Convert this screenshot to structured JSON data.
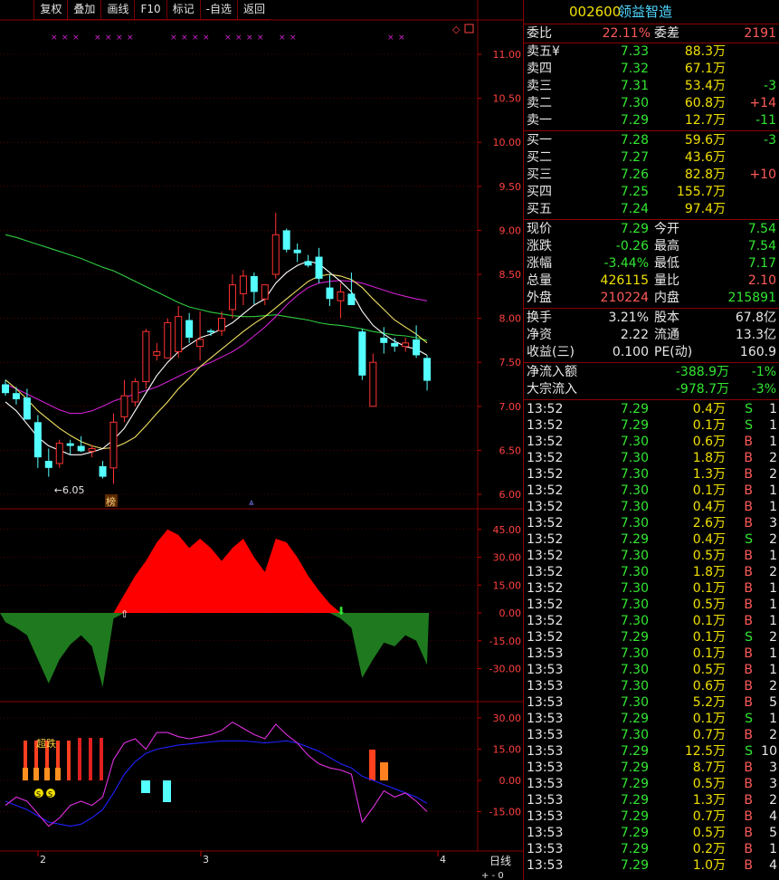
{
  "toolbar": {
    "buttons": [
      "复权",
      "叠加",
      "画线",
      "F10",
      "标记",
      "-自选",
      "返回"
    ]
  },
  "stock": {
    "code": "002600",
    "name": "领益智造"
  },
  "chart": {
    "price_ticks": [
      "11.00",
      "10.50",
      "10.00",
      "9.50",
      "9.00",
      "8.50",
      "8.00",
      "7.50",
      "7.00",
      "6.50",
      "6.00"
    ],
    "low_label": "6.05",
    "rank_label": "榜",
    "macd_ticks": [
      "45.00",
      "30.00",
      "15.00",
      "0.00",
      "-15.00",
      "-30.00"
    ],
    "ind_ticks": [
      "30.00",
      "15.00",
      "0.00",
      "-15.00"
    ],
    "ind_label": "超跌",
    "ind_small": [
      "S",
      "S"
    ],
    "date_labels": [
      "2",
      "3",
      "4"
    ],
    "period_label": "日线",
    "period_controls": "+ - 0",
    "colors": {
      "up": "#ff3232",
      "down": "#54ffff",
      "ma5": "#ffffff",
      "ma10": "#f0e060",
      "ma20": "#2ecc40",
      "ma60": "#d020d0",
      "macd_pos": "#ff0000",
      "macd_neg": "#1f7a1f"
    },
    "candles": [
      {
        "o": 7.25,
        "h": 7.3,
        "l": 7.12,
        "c": 7.15
      },
      {
        "o": 7.15,
        "h": 7.22,
        "l": 7.02,
        "c": 7.08
      },
      {
        "o": 7.1,
        "h": 7.2,
        "l": 6.85,
        "c": 6.85
      },
      {
        "o": 6.82,
        "h": 6.9,
        "l": 6.3,
        "c": 6.42
      },
      {
        "o": 6.38,
        "h": 6.52,
        "l": 6.2,
        "c": 6.3
      },
      {
        "o": 6.35,
        "h": 6.62,
        "l": 6.3,
        "c": 6.58
      },
      {
        "o": 6.58,
        "h": 6.62,
        "l": 6.45,
        "c": 6.55
      },
      {
        "o": 6.55,
        "h": 6.66,
        "l": 6.48,
        "c": 6.49
      },
      {
        "o": 6.49,
        "h": 6.56,
        "l": 6.42,
        "c": 6.52
      },
      {
        "o": 6.32,
        "h": 6.38,
        "l": 6.18,
        "c": 6.2
      },
      {
        "o": 6.3,
        "h": 6.92,
        "l": 6.12,
        "c": 6.82
      },
      {
        "o": 6.88,
        "h": 7.3,
        "l": 6.82,
        "c": 7.12
      },
      {
        "o": 7.05,
        "h": 7.32,
        "l": 7.0,
        "c": 7.28
      },
      {
        "o": 7.28,
        "h": 7.88,
        "l": 7.2,
        "c": 7.85
      },
      {
        "o": 7.58,
        "h": 7.72,
        "l": 7.52,
        "c": 7.62
      },
      {
        "o": 7.55,
        "h": 8.0,
        "l": 7.55,
        "c": 7.95
      },
      {
        "o": 7.62,
        "h": 8.14,
        "l": 7.55,
        "c": 8.02
      },
      {
        "o": 7.98,
        "h": 8.06,
        "l": 7.72,
        "c": 7.78
      },
      {
        "o": 7.68,
        "h": 8.08,
        "l": 7.52,
        "c": 7.76
      },
      {
        "o": 7.86,
        "h": 7.88,
        "l": 7.8,
        "c": 7.84
      },
      {
        "o": 7.86,
        "h": 8.08,
        "l": 7.8,
        "c": 8.0
      },
      {
        "o": 8.1,
        "h": 8.5,
        "l": 8.0,
        "c": 8.38
      },
      {
        "o": 8.28,
        "h": 8.55,
        "l": 8.15,
        "c": 8.48
      },
      {
        "o": 8.48,
        "h": 8.52,
        "l": 8.16,
        "c": 8.3
      },
      {
        "o": 8.22,
        "h": 8.38,
        "l": 8.15,
        "c": 8.38
      },
      {
        "o": 8.5,
        "h": 9.2,
        "l": 8.45,
        "c": 8.95
      },
      {
        "o": 9.0,
        "h": 9.02,
        "l": 8.75,
        "c": 8.78
      },
      {
        "o": 8.78,
        "h": 8.85,
        "l": 8.64,
        "c": 8.74
      },
      {
        "o": 8.65,
        "h": 8.72,
        "l": 8.58,
        "c": 8.6
      },
      {
        "o": 8.7,
        "h": 8.8,
        "l": 8.4,
        "c": 8.45
      },
      {
        "o": 8.35,
        "h": 8.5,
        "l": 8.14,
        "c": 8.22
      },
      {
        "o": 8.2,
        "h": 8.4,
        "l": 8.0,
        "c": 8.3
      },
      {
        "o": 8.28,
        "h": 8.52,
        "l": 8.15,
        "c": 8.15
      },
      {
        "o": 7.85,
        "h": 7.88,
        "l": 7.3,
        "c": 7.35
      },
      {
        "o": 7.0,
        "h": 7.6,
        "l": 7.0,
        "c": 7.5
      },
      {
        "o": 7.78,
        "h": 7.9,
        "l": 7.6,
        "c": 7.72
      },
      {
        "o": 7.72,
        "h": 7.78,
        "l": 7.62,
        "c": 7.68
      },
      {
        "o": 7.68,
        "h": 7.78,
        "l": 7.62,
        "c": 7.72
      },
      {
        "o": 7.76,
        "h": 7.92,
        "l": 7.55,
        "c": 7.58
      },
      {
        "o": 7.55,
        "h": 7.58,
        "l": 7.18,
        "c": 7.29
      }
    ],
    "ma5": [
      7.05,
      6.95,
      6.8,
      6.65,
      6.55,
      6.5,
      6.45,
      6.45,
      6.48,
      6.52,
      6.62,
      6.75,
      6.95,
      7.15,
      7.35,
      7.5,
      7.62,
      7.7,
      7.78,
      7.82,
      7.88,
      7.95,
      8.05,
      8.15,
      8.22,
      8.4,
      8.52,
      8.6,
      8.65,
      8.62,
      8.52,
      8.42,
      8.3,
      8.08,
      7.92,
      7.82,
      7.74,
      7.68,
      7.65,
      7.58
    ],
    "ma10": [
      7.3,
      7.2,
      7.08,
      6.95,
      6.85,
      6.75,
      6.67,
      6.6,
      6.55,
      6.52,
      6.53,
      6.58,
      6.65,
      6.78,
      6.92,
      7.05,
      7.2,
      7.32,
      7.45,
      7.55,
      7.65,
      7.75,
      7.85,
      7.94,
      8.02,
      8.12,
      8.22,
      8.32,
      8.42,
      8.48,
      8.5,
      8.48,
      8.44,
      8.35,
      8.22,
      8.1,
      7.98,
      7.9,
      7.82,
      7.72
    ],
    "ma20": [
      8.95,
      8.92,
      8.88,
      8.84,
      8.8,
      8.76,
      8.72,
      8.68,
      8.63,
      8.58,
      8.54,
      8.48,
      8.42,
      8.36,
      8.3,
      8.24,
      8.18,
      8.13,
      8.1,
      8.07,
      8.05,
      8.03,
      8.02,
      8.02,
      8.03,
      8.04,
      8.02,
      8.0,
      7.98,
      7.95,
      7.93,
      7.92,
      7.9,
      7.88,
      7.85,
      7.83,
      7.81,
      7.8,
      7.78,
      7.75
    ],
    "ma60": [
      7.25,
      7.2,
      7.14,
      7.08,
      7.02,
      6.96,
      6.92,
      6.92,
      6.95,
      7.0,
      7.06,
      7.1,
      7.14,
      7.18,
      7.22,
      7.28,
      7.34,
      7.4,
      7.45,
      7.5,
      7.56,
      7.62,
      7.7,
      7.8,
      7.9,
      8.02,
      8.15,
      8.26,
      8.35,
      8.4,
      8.42,
      8.43,
      8.42,
      8.4,
      8.36,
      8.32,
      8.28,
      8.25,
      8.22,
      8.2
    ],
    "macd": [
      -5,
      -8,
      -12,
      -25,
      -38,
      -25,
      -17,
      -12,
      -18,
      -40,
      -3,
      10,
      20,
      28,
      38,
      45,
      42,
      35,
      40,
      35,
      28,
      35,
      40,
      30,
      22,
      40,
      38,
      30,
      20,
      12,
      5,
      -3,
      -8,
      -35,
      -25,
      -16,
      -18,
      -12,
      -15,
      -28
    ],
    "ind_line1": [
      -10,
      -12,
      -14,
      -17,
      -20,
      -21,
      -22,
      -21,
      -18,
      -14,
      -6,
      3,
      9,
      13,
      15,
      16,
      17,
      17.5,
      18,
      18.5,
      19,
      19,
      19,
      18.5,
      18,
      18.5,
      19,
      18,
      16,
      14,
      11,
      8,
      6,
      2,
      0,
      -2,
      -4,
      -6,
      -8,
      -11
    ],
    "ind_line2": [
      -12,
      -8,
      -10,
      -16,
      -22,
      -18,
      -12,
      -10,
      -12,
      -8,
      10,
      18,
      20,
      15,
      23,
      23,
      21,
      20,
      21,
      22,
      24,
      28,
      25,
      22,
      20,
      27,
      22,
      18,
      12,
      8,
      6,
      5,
      3,
      -20,
      -13,
      -5,
      -8,
      -6,
      -10,
      -15
    ]
  },
  "quote": {
    "header": [
      {
        "k": "委比",
        "v": "22.11%",
        "k2": "委差",
        "v2": "2191"
      }
    ],
    "sell": [
      {
        "k": "卖五¥",
        "p": "7.33",
        "v": "88.3万",
        "d": ""
      },
      {
        "k": "卖四",
        "p": "7.32",
        "v": "67.1万",
        "d": ""
      },
      {
        "k": "卖三",
        "p": "7.31",
        "v": "53.4万",
        "d": "-3"
      },
      {
        "k": "卖二",
        "p": "7.30",
        "v": "60.8万",
        "d": "+14"
      },
      {
        "k": "卖一",
        "p": "7.29",
        "v": "12.7万",
        "d": "-11"
      }
    ],
    "buy": [
      {
        "k": "买一",
        "p": "7.28",
        "v": "59.6万",
        "d": "-3"
      },
      {
        "k": "买二",
        "p": "7.27",
        "v": "43.6万",
        "d": ""
      },
      {
        "k": "买三",
        "p": "7.26",
        "v": "82.8万",
        "d": "+10"
      },
      {
        "k": "买四",
        "p": "7.25",
        "v": "155.7万",
        "d": ""
      },
      {
        "k": "买五",
        "p": "7.24",
        "v": "97.4万",
        "d": ""
      }
    ],
    "stats1": [
      {
        "k": "现价",
        "v": "7.29",
        "k2": "今开",
        "v2": "7.54"
      },
      {
        "k": "涨跌",
        "v": "-0.26",
        "k2": "最高",
        "v2": "7.54"
      },
      {
        "k": "涨幅",
        "v": "-3.44%",
        "k2": "最低",
        "v2": "7.17"
      },
      {
        "k": "总量",
        "v": "426115",
        "k2": "量比",
        "v2": "2.10"
      },
      {
        "k": "外盘",
        "v": "210224",
        "k2": "内盘",
        "v2": "215891"
      }
    ],
    "stats2": [
      {
        "k": "换手",
        "v": "3.21%",
        "k2": "股本",
        "v2": "67.8亿"
      },
      {
        "k": "净资",
        "v": "2.22",
        "k2": "流通",
        "v2": "13.3亿"
      },
      {
        "k": "收益(三)",
        "v": "0.100",
        "k2": "PE(动)",
        "v2": "160.9"
      }
    ],
    "flow": [
      {
        "k": "净流入额",
        "v": "-388.9万",
        "p": "-1%"
      },
      {
        "k": "大宗流入",
        "v": "-978.7万",
        "p": "-3%"
      }
    ]
  },
  "ticks": [
    {
      "t": "13:52",
      "p": "7.29",
      "v": "0.4万",
      "s": "S",
      "n": "1"
    },
    {
      "t": "13:52",
      "p": "7.29",
      "v": "0.1万",
      "s": "S",
      "n": "1"
    },
    {
      "t": "13:52",
      "p": "7.30",
      "v": "0.6万",
      "s": "B",
      "n": "1"
    },
    {
      "t": "13:52",
      "p": "7.30",
      "v": "1.8万",
      "s": "B",
      "n": "2"
    },
    {
      "t": "13:52",
      "p": "7.30",
      "v": "1.3万",
      "s": "B",
      "n": "2"
    },
    {
      "t": "13:52",
      "p": "7.30",
      "v": "0.1万",
      "s": "B",
      "n": "1"
    },
    {
      "t": "13:52",
      "p": "7.30",
      "v": "0.4万",
      "s": "B",
      "n": "1"
    },
    {
      "t": "13:52",
      "p": "7.30",
      "v": "2.6万",
      "s": "B",
      "n": "3"
    },
    {
      "t": "13:52",
      "p": "7.29",
      "v": "0.4万",
      "s": "S",
      "n": "2"
    },
    {
      "t": "13:52",
      "p": "7.30",
      "v": "0.5万",
      "s": "B",
      "n": "1"
    },
    {
      "t": "13:52",
      "p": "7.30",
      "v": "1.8万",
      "s": "B",
      "n": "2"
    },
    {
      "t": "13:52",
      "p": "7.30",
      "v": "0.1万",
      "s": "B",
      "n": "1"
    },
    {
      "t": "13:52",
      "p": "7.30",
      "v": "0.5万",
      "s": "B",
      "n": "1"
    },
    {
      "t": "13:52",
      "p": "7.30",
      "v": "0.1万",
      "s": "B",
      "n": "1"
    },
    {
      "t": "13:52",
      "p": "7.29",
      "v": "0.1万",
      "s": "S",
      "n": "2"
    },
    {
      "t": "13:53",
      "p": "7.30",
      "v": "0.1万",
      "s": "B",
      "n": "1"
    },
    {
      "t": "13:53",
      "p": "7.30",
      "v": "0.5万",
      "s": "B",
      "n": "1"
    },
    {
      "t": "13:53",
      "p": "7.30",
      "v": "0.6万",
      "s": "B",
      "n": "2"
    },
    {
      "t": "13:53",
      "p": "7.30",
      "v": "5.2万",
      "s": "B",
      "n": "5"
    },
    {
      "t": "13:53",
      "p": "7.29",
      "v": "0.1万",
      "s": "S",
      "n": "1"
    },
    {
      "t": "13:53",
      "p": "7.30",
      "v": "0.7万",
      "s": "B",
      "n": "2"
    },
    {
      "t": "13:53",
      "p": "7.29",
      "v": "12.5万",
      "s": "S",
      "n": "10"
    },
    {
      "t": "13:53",
      "p": "7.29",
      "v": "8.7万",
      "s": "B",
      "n": "3"
    },
    {
      "t": "13:53",
      "p": "7.29",
      "v": "0.5万",
      "s": "B",
      "n": "3"
    },
    {
      "t": "13:53",
      "p": "7.29",
      "v": "1.3万",
      "s": "B",
      "n": "2"
    },
    {
      "t": "13:53",
      "p": "7.29",
      "v": "0.7万",
      "s": "B",
      "n": "4"
    },
    {
      "t": "13:53",
      "p": "7.29",
      "v": "0.5万",
      "s": "B",
      "n": "5"
    },
    {
      "t": "13:53",
      "p": "7.29",
      "v": "0.2万",
      "s": "B",
      "n": "1"
    },
    {
      "t": "13:53",
      "p": "7.29",
      "v": "1.0万",
      "s": "B",
      "n": "4"
    }
  ]
}
